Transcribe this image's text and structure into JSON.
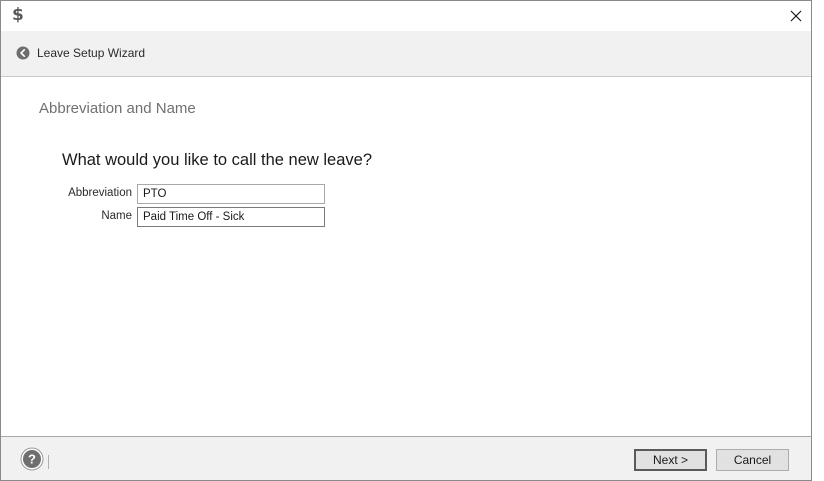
{
  "window": {
    "app_icon_glyph": "$",
    "close_glyph": "✕"
  },
  "header": {
    "back_icon": "back-arrow-icon",
    "title": "Leave Setup Wizard"
  },
  "content": {
    "section_heading": "Abbreviation and Name",
    "question": "What would you like to call the new leave?",
    "fields": {
      "abbreviation": {
        "label": "Abbreviation",
        "value": "PTO"
      },
      "name": {
        "label": "Name",
        "value": "Paid Time Off - Sick"
      }
    }
  },
  "footer": {
    "help_icon": "help-icon",
    "next_label": "Next >",
    "cancel_label": "Cancel"
  },
  "colors": {
    "header_bg": "#f1f1f1",
    "border": "#a8a8a8",
    "button_bg": "#e1e1e1"
  }
}
